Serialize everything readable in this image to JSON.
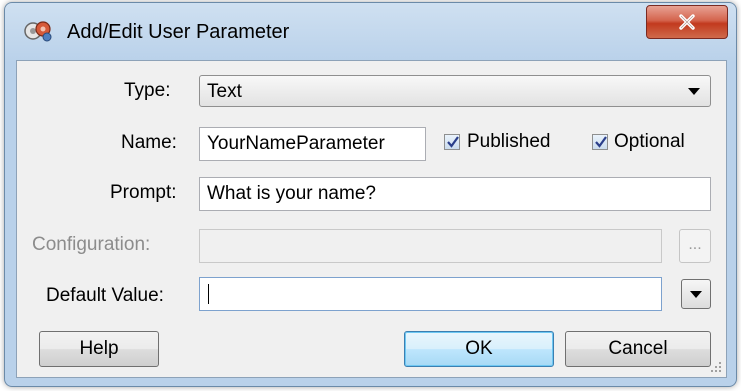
{
  "window": {
    "title": "Add/Edit User Parameter",
    "close_label": "X"
  },
  "form": {
    "type": {
      "label": "Type:",
      "value": "Text"
    },
    "name": {
      "label": "Name:",
      "value": "YourNameParameter"
    },
    "published": {
      "label": "Published",
      "checked": true
    },
    "optional": {
      "label": "Optional",
      "checked": true
    },
    "prompt": {
      "label": "Prompt:",
      "value": "What is your name?"
    },
    "configuration": {
      "label": "Configuration:",
      "value": "",
      "enabled": false,
      "browse_label": "..."
    },
    "default_value": {
      "label": "Default Value:",
      "value": ""
    }
  },
  "buttons": {
    "help": "Help",
    "ok": "OK",
    "cancel": "Cancel"
  },
  "colors": {
    "window_frame": "#b9d1ea",
    "client": "#f0f0f0",
    "close_button": "#c23a1e",
    "default_button": "#3c7fb1"
  }
}
